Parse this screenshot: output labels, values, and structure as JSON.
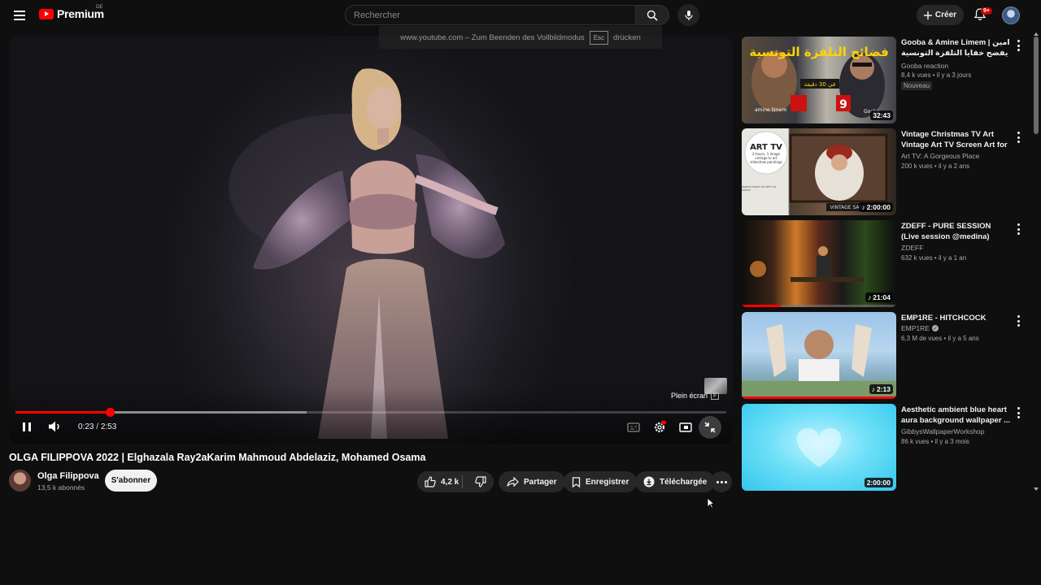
{
  "header": {
    "logo_text": "Premium",
    "logo_region": "DE",
    "search_placeholder": "Rechercher",
    "create_label": "Créer",
    "notification_count": "9+"
  },
  "fullscreen_hint": {
    "prefix": "www.youtube.com – Zum Beenden des Vollbildmodus",
    "key": "Esc",
    "suffix": "drücken"
  },
  "player": {
    "current_time": "0:23",
    "duration": "2:53",
    "progress_fraction": 0.133,
    "buffered_fraction": 0.41,
    "fullscreen_tooltip": "Plein écran",
    "fullscreen_key": "F"
  },
  "video": {
    "title": "OLGA FILIPPOVA 2022 | Elghazala Ray2aKarim Mahmoud Abdelaziz, Mohamed Osama",
    "channel": "Olga Filippova",
    "subscribers": "13,5 k abonnés",
    "subscribe_label": "S'abonner",
    "likes": "4,2 k",
    "share_label": "Partager",
    "save_label": "Enregistrer",
    "download_label": "Téléchargée"
  },
  "recommendations": [
    {
      "title": "Gooba & Amine Limem | امين يفضح خفايا التلفزة التونسية 😨",
      "channel": "Gooba reaction",
      "verified": false,
      "meta": "8,4 k vues • il y a 3 jours",
      "badge": "Nouveau",
      "duration": "32:43",
      "music_icon": false,
      "watched_fraction": 0
    },
    {
      "title": "Vintage Christmas TV Art Vintage Art TV Screen Art for ...",
      "channel": "Art TV: A Gorgeous Place",
      "verified": false,
      "meta": "200 k vues • il y a 2 ans",
      "badge": "",
      "duration": "2:00:00",
      "music_icon": true,
      "watched_fraction": 0
    },
    {
      "title": "ZDEFF - PURE SESSION (Live session @medina)",
      "channel": "ZDEFF",
      "verified": false,
      "meta": "632 k vues • il y a 1 an",
      "badge": "",
      "duration": "21:04",
      "music_icon": true,
      "watched_fraction": 0.25
    },
    {
      "title": "EMP1RE - HITCHCOCK",
      "channel": "EMP1RE",
      "verified": true,
      "meta": "6,3 M de vues • il y a 5 ans",
      "badge": "",
      "duration": "2:13",
      "music_icon": true,
      "watched_fraction": 1
    },
    {
      "title": "Aesthetic ambient blue heart aura background wallpaper ...",
      "channel": "GibbysWallpaperWorkshop",
      "verified": false,
      "meta": "86 k vues • il y a 3 mois",
      "badge": "",
      "duration": "2:00:00",
      "music_icon": false,
      "watched_fraction": 0
    }
  ],
  "thumb_text": {
    "t1_arabic": "فضائح التلفزة التونسية",
    "t1_sub": "في 30 دقيقة",
    "t1_left_name": "amine limem",
    "t1_right_name": "Gooba",
    "t2_title": "ART TV",
    "t2_sub": "2-hours, 1 image vintage tv art slideshow paintings",
    "t2_bottom": "VINTAGE SANTA TV ART",
    "t2_note": "digital frame art with no sound"
  },
  "colors": {
    "accent_red": "#ff0000",
    "bg": "#0f0f0f",
    "pill_bg": "#272727"
  }
}
